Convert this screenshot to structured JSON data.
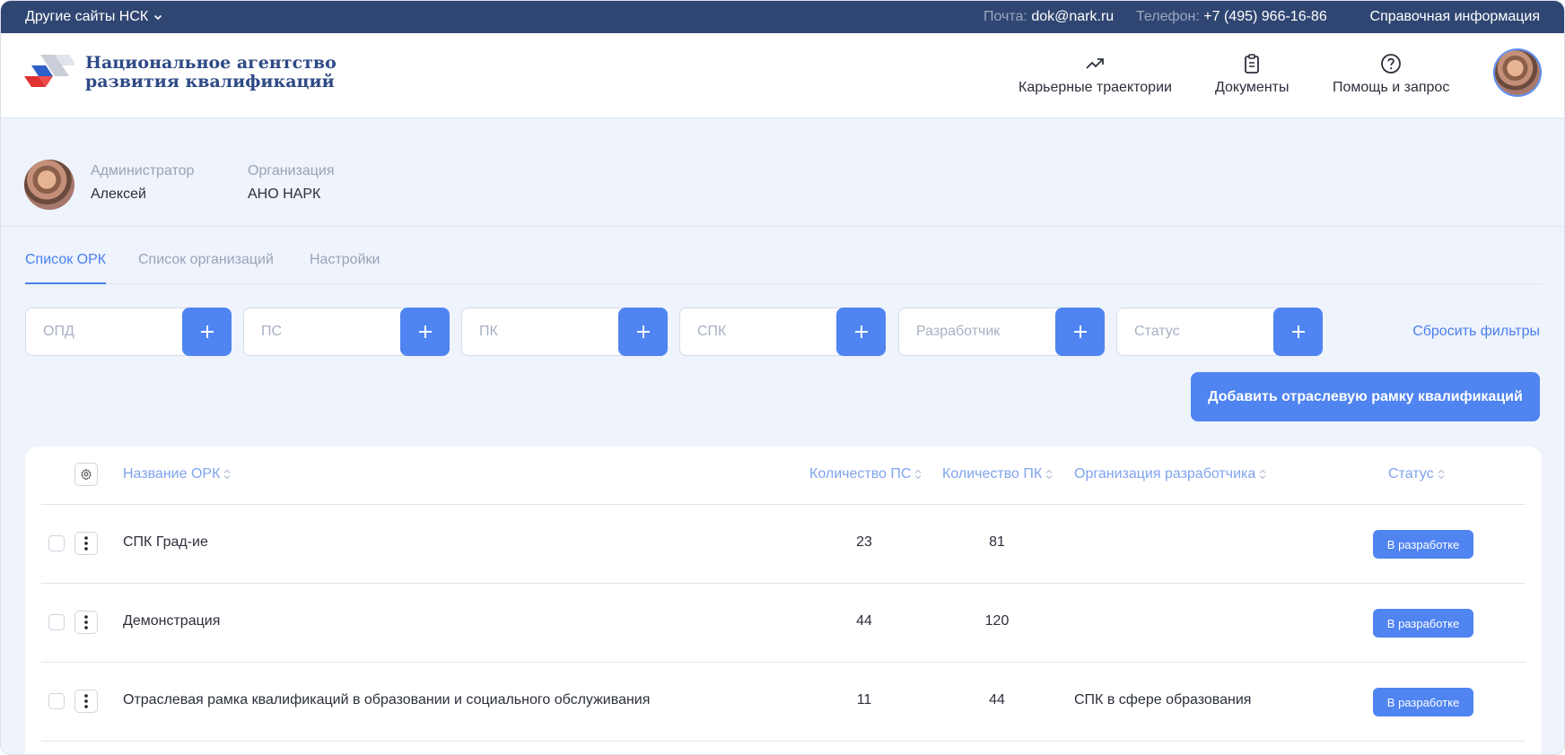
{
  "colors": {
    "topbar": "#304672",
    "accent": "#4f84f1",
    "link": "#4a7ff0",
    "background": "#eef3fc"
  },
  "topbar": {
    "sites_label": "Другие сайты НСК",
    "mail_label": "Почта:",
    "mail_value": "dok@nark.ru",
    "phone_label": "Телефон:",
    "phone_value": "+7 (495) 966-16-86",
    "help_label": "Справочная информация"
  },
  "header": {
    "logo_line1": "Национальное агентство",
    "logo_line2": "развития квалификаций",
    "nav": [
      {
        "label": "Карьерные траектории",
        "icon": "trending-up-icon"
      },
      {
        "label": "Документы",
        "icon": "clipboard-icon"
      },
      {
        "label": "Помощь и запрос",
        "icon": "question-circle-icon"
      }
    ]
  },
  "profile": {
    "role_label": "Администратор",
    "name": "Алексей",
    "org_label": "Организация",
    "org_value": "АНО НАРК"
  },
  "tabs": [
    {
      "label": "Список ОРК",
      "active": true
    },
    {
      "label": "Список организаций",
      "active": false
    },
    {
      "label": "Настройки",
      "active": false
    }
  ],
  "filters": [
    {
      "placeholder": "ОПД"
    },
    {
      "placeholder": "ПС"
    },
    {
      "placeholder": "ПК"
    },
    {
      "placeholder": "СПК"
    },
    {
      "placeholder": "Разработчик"
    },
    {
      "placeholder": "Статус"
    }
  ],
  "reset_filters": "Сбросить фильтры",
  "add_button": "Добавить отраслевую рамку квалификаций",
  "table": {
    "columns": [
      "Название ОРК",
      "Количество ПС",
      "Количество ПК",
      "Организация разработчика",
      "Статус"
    ],
    "rows": [
      {
        "name": "СПК Град-ие",
        "ps": "23",
        "pk": "81",
        "org": "",
        "status": "В разработке"
      },
      {
        "name": "Демонстрация",
        "ps": "44",
        "pk": "120",
        "org": "",
        "status": "В разработке"
      },
      {
        "name": "Отраслевая рамка квалификаций в образовании и социального обслуживания",
        "ps": "11",
        "pk": "44",
        "org": "СПК в сфере образования",
        "status": "В разработке"
      }
    ]
  }
}
